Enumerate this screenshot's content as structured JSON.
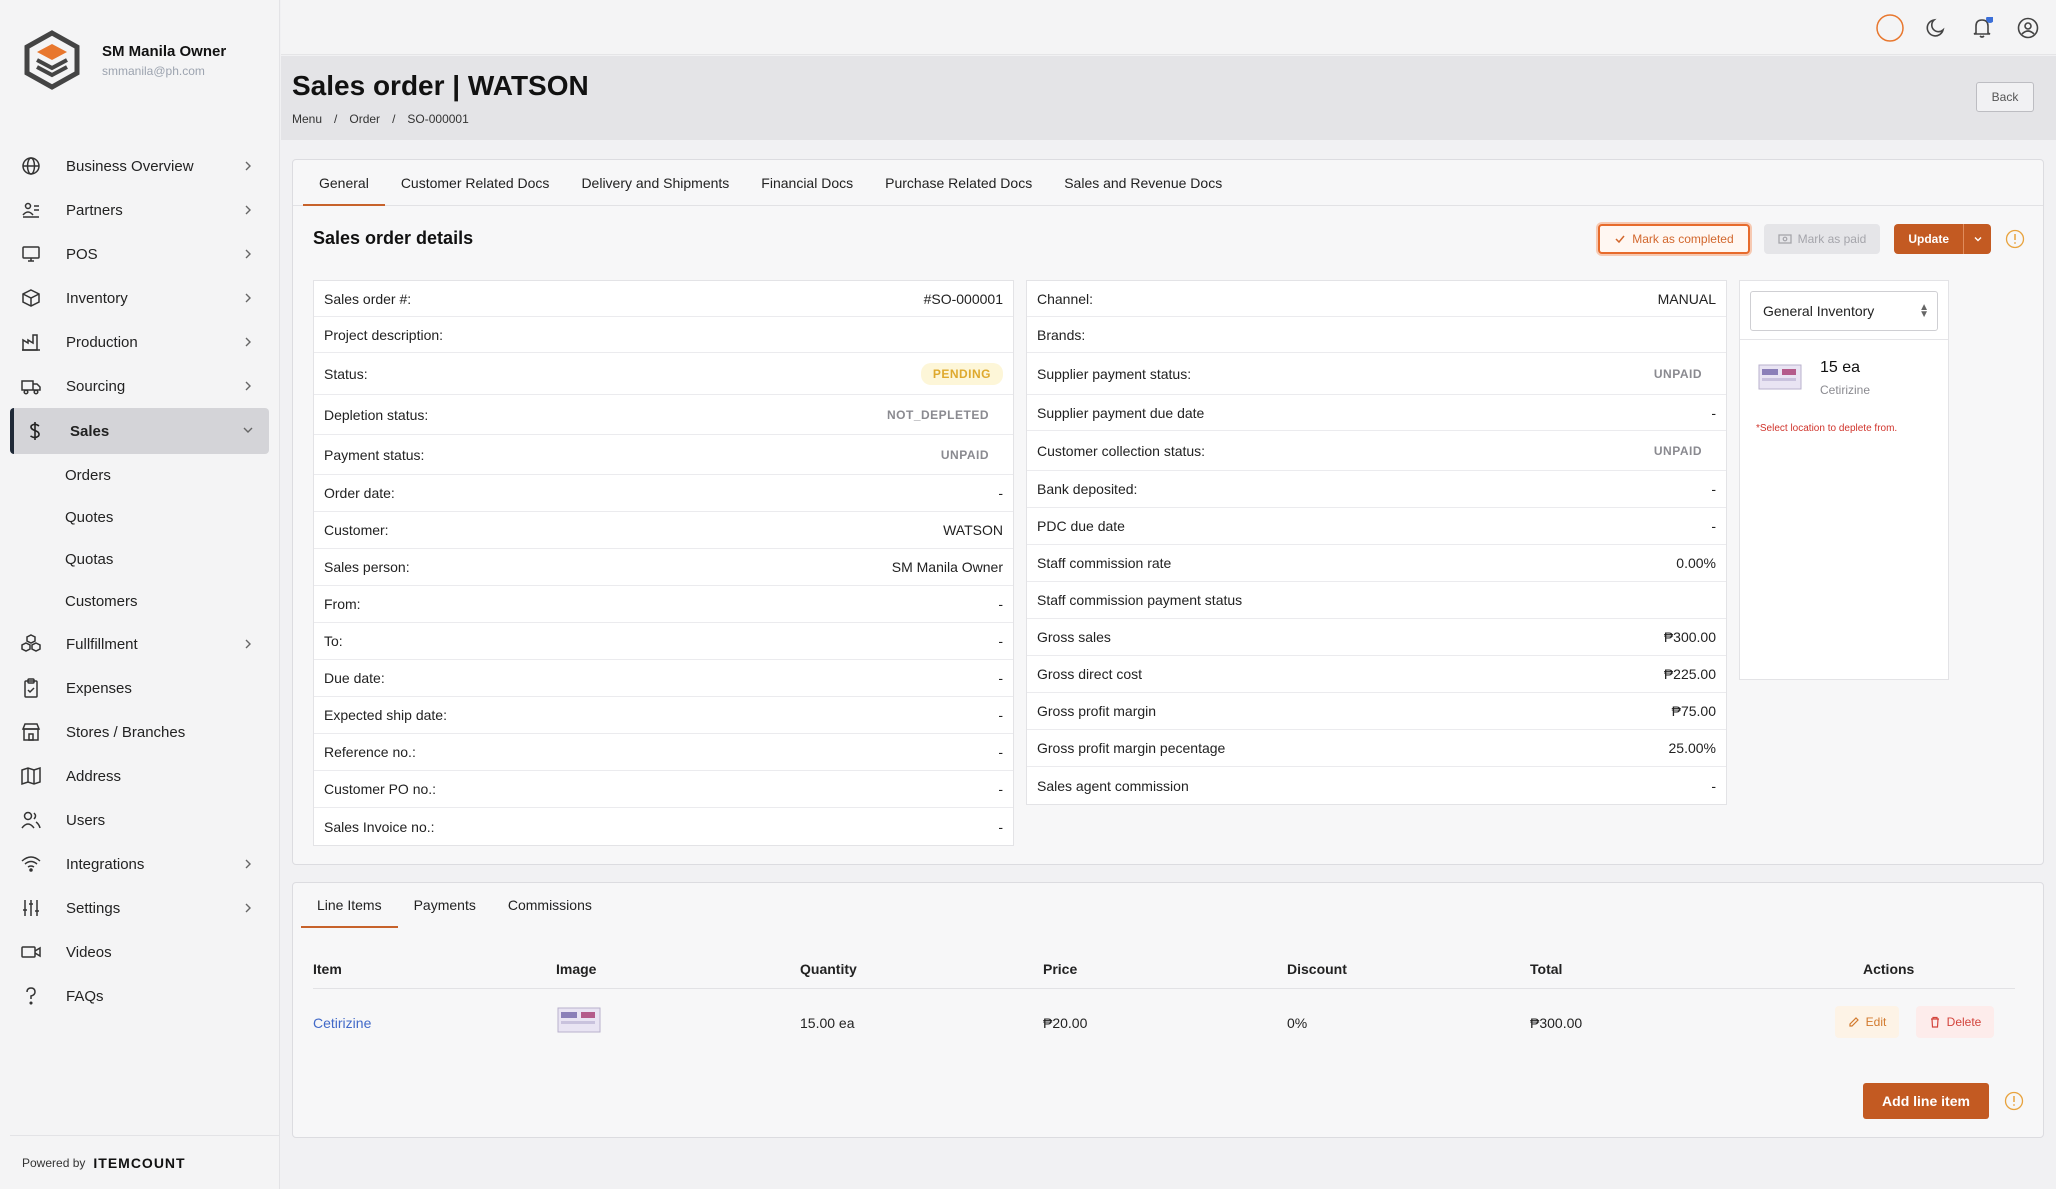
{
  "user": {
    "name": "SM Manila Owner",
    "email": "smmanila@ph.com"
  },
  "sidebar": {
    "items": [
      {
        "label": "Business Overview",
        "icon": "globe-icon",
        "chevron": true
      },
      {
        "label": "Partners",
        "icon": "partners-icon",
        "chevron": true
      },
      {
        "label": "POS",
        "icon": "pos-icon",
        "chevron": true
      },
      {
        "label": "Inventory",
        "icon": "box-icon",
        "chevron": true
      },
      {
        "label": "Production",
        "icon": "factory-icon",
        "chevron": true
      },
      {
        "label": "Sourcing",
        "icon": "truck-icon",
        "chevron": true
      },
      {
        "label": "Sales",
        "icon": "dollar-icon",
        "chevron": true,
        "active": true
      },
      {
        "label": "Fullfillment",
        "icon": "boxes-icon",
        "chevron": true
      },
      {
        "label": "Expenses",
        "icon": "clipboard-icon",
        "chevron": false
      },
      {
        "label": "Stores / Branches",
        "icon": "store-icon",
        "chevron": false
      },
      {
        "label": "Address",
        "icon": "map-icon",
        "chevron": false
      },
      {
        "label": "Users",
        "icon": "users-icon",
        "chevron": false
      },
      {
        "label": "Integrations",
        "icon": "wifi-icon",
        "chevron": true
      },
      {
        "label": "Settings",
        "icon": "sliders-icon",
        "chevron": true
      },
      {
        "label": "Videos",
        "icon": "video-icon",
        "chevron": false
      },
      {
        "label": "FAQs",
        "icon": "question-icon",
        "chevron": false
      }
    ],
    "sales_sub": [
      "Orders",
      "Quotes",
      "Quotas",
      "Customers"
    ],
    "powered_by": "Powered by",
    "powered_brand": "ITEMCOUNT"
  },
  "header": {
    "title": "Sales order | WATSON",
    "breadcrumbs": [
      "Menu",
      "/",
      "Order",
      "/",
      "SO-000001"
    ],
    "back_label": "Back"
  },
  "tabs": [
    "General",
    "Customer Related Docs",
    "Delivery and Shipments",
    "Financial Docs",
    "Purchase Related Docs",
    "Sales and Revenue Docs"
  ],
  "details": {
    "title": "Sales order details",
    "mark_completed": "Mark as completed",
    "mark_paid": "Mark as paid",
    "update": "Update",
    "left": [
      {
        "label": "Sales order #:",
        "value": "#SO-000001"
      },
      {
        "label": "Project description:",
        "value": ""
      },
      {
        "label": "Status:",
        "value": "PENDING",
        "type": "pending"
      },
      {
        "label": "Depletion status:",
        "value": "NOT_DEPLETED",
        "type": "grey"
      },
      {
        "label": "Payment status:",
        "value": "UNPAID",
        "type": "grey"
      },
      {
        "label": "Order date:",
        "value": "-"
      },
      {
        "label": "Customer:",
        "value": "WATSON"
      },
      {
        "label": "Sales person:",
        "value": "SM Manila Owner"
      },
      {
        "label": "From:",
        "value": "-"
      },
      {
        "label": "To:",
        "value": "-"
      },
      {
        "label": "Due date:",
        "value": "-"
      },
      {
        "label": "Expected ship date:",
        "value": "-"
      },
      {
        "label": "Reference no.:",
        "value": "-"
      },
      {
        "label": "Customer PO no.:",
        "value": "-"
      },
      {
        "label": "Sales Invoice no.:",
        "value": "-"
      }
    ],
    "right": [
      {
        "label": "Channel:",
        "value": "MANUAL"
      },
      {
        "label": "Brands:",
        "value": ""
      },
      {
        "label": "Supplier payment status:",
        "value": "UNPAID",
        "type": "grey"
      },
      {
        "label": "Supplier payment due date",
        "value": "-"
      },
      {
        "label": "Customer collection status:",
        "value": "UNPAID",
        "type": "grey"
      },
      {
        "label": "Bank deposited:",
        "value": "-"
      },
      {
        "label": "PDC due date",
        "value": "-"
      },
      {
        "label": "Staff commission rate",
        "value": "0.00%"
      },
      {
        "label": "Staff commission payment status",
        "value": ""
      },
      {
        "label": "Gross sales",
        "value": "₱300.00"
      },
      {
        "label": "Gross direct cost",
        "value": "₱225.00"
      },
      {
        "label": "Gross profit margin",
        "value": "₱75.00"
      },
      {
        "label": "Gross profit margin pecentage",
        "value": "25.00%"
      },
      {
        "label": "Sales agent commission",
        "value": "-"
      }
    ]
  },
  "inventory": {
    "location": "General Inventory",
    "qty": "15 ea",
    "item": "Cetirizine",
    "warning": "*Select location to deplete from."
  },
  "line_tabs": [
    "Line Items",
    "Payments",
    "Commissions"
  ],
  "line_table": {
    "headers": [
      "Item",
      "Image",
      "Quantity",
      "Price",
      "Discount",
      "Total",
      "Actions"
    ],
    "rows": [
      {
        "item": "Cetirizine",
        "quantity": "15.00 ea",
        "price": "₱20.00",
        "discount": "0%",
        "total": "₱300.00"
      }
    ],
    "edit": "Edit",
    "delete": "Delete",
    "add": "Add line item"
  }
}
